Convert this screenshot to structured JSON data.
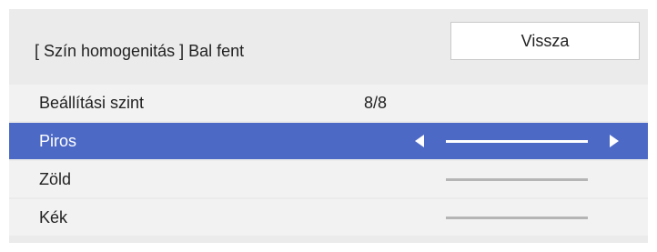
{
  "header": {
    "title": "[ Szín homogenitás ] Bal fent",
    "back_label": "Vissza"
  },
  "menu": {
    "level_label": "Beállítási szint",
    "level_value": "8/8",
    "items": [
      {
        "label": "Piros",
        "selected": true
      },
      {
        "label": "Zöld",
        "selected": false
      },
      {
        "label": "Kék",
        "selected": false
      }
    ]
  },
  "colors": {
    "panel_bg": "#ebebeb",
    "row_bg": "#f2f2f2",
    "selected_bg": "#4c69c6",
    "slider_line": "#b5b5b5"
  },
  "icons": {
    "decrease": "arrow-left-icon",
    "increase": "arrow-right-icon"
  }
}
